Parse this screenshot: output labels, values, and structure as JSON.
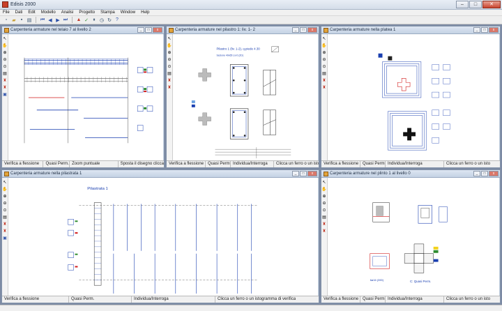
{
  "app": {
    "title": "Edisis 2000"
  },
  "window_controls": {
    "minimize": "–",
    "maximize": "□",
    "close": "✕"
  },
  "menu": [
    "File",
    "Dati",
    "Edit",
    "Modello",
    "Analisi",
    "Progetto",
    "Stampa",
    "Window",
    "Help"
  ],
  "toolbar_icons": [
    "new-icon",
    "open-icon",
    "save-icon",
    "print-icon",
    "first-icon",
    "previous-icon",
    "next-icon",
    "last-icon",
    "calc-icon",
    "check-icon",
    "pause-icon",
    "timer-icon",
    "refresh-icon",
    "help-icon"
  ],
  "child_controls": {
    "minimize": "_",
    "maximize": "□",
    "close": "x"
  },
  "windows": {
    "telaio": {
      "title": "Carpenteria armature nel telaio 7 al livello 2",
      "status": [
        "Verifica a flessione",
        "Quasi Perm.",
        "Zoom puntuale",
        "Sposta il disegno cliccano"
      ]
    },
    "pilastro": {
      "title": "Carpenteria armature nel pilastro 1:  liv. 1- 2",
      "status": [
        "Verifica a flessione",
        "Quasi Perm.",
        "Individua/Interroga",
        "Clicca un ferro o un istog"
      ],
      "drawing": {
        "heading": "Pilastro 1 (liv. 1-2), q.piede 4.30",
        "subheading": "Sezione 40x65 Liv.0 (2D)"
      }
    },
    "platea": {
      "title": "Carpenteria armature nella platea 1",
      "status": [
        "Verifica a flessione",
        "Quasi Perm.",
        "Individua/Interroga",
        "Clicca un ferro o un isto"
      ]
    },
    "pilastrata": {
      "title": "Carpenteria armature nella pilastrata 1",
      "status": [
        "Verifica a flessione",
        "Quasi Perm.",
        "Individua/Interroga",
        "Clicca un ferro o un istogramma di verifica"
      ],
      "drawing": {
        "heading": "Pilastrata 1"
      }
    },
    "plinto": {
      "title": "Carpenteria armature nel plinto 1 al livello 0",
      "status": [
        "Verifica a flessione",
        "Quasi Perm.",
        "Individua/Interroga",
        "Clicca un ferro o un isto"
      ],
      "drawing": {
        "caption": "C: Quasi Perm.",
        "bar_label": "6ø16 (390)"
      }
    }
  },
  "colors": {
    "mdi_bg": "#7d8ba4",
    "rebar_blue": "#1a3fb0",
    "rebar_green": "#2e8b2e",
    "rebar_red": "#d11a1a",
    "highlight_yellow": "#f2d21a"
  }
}
